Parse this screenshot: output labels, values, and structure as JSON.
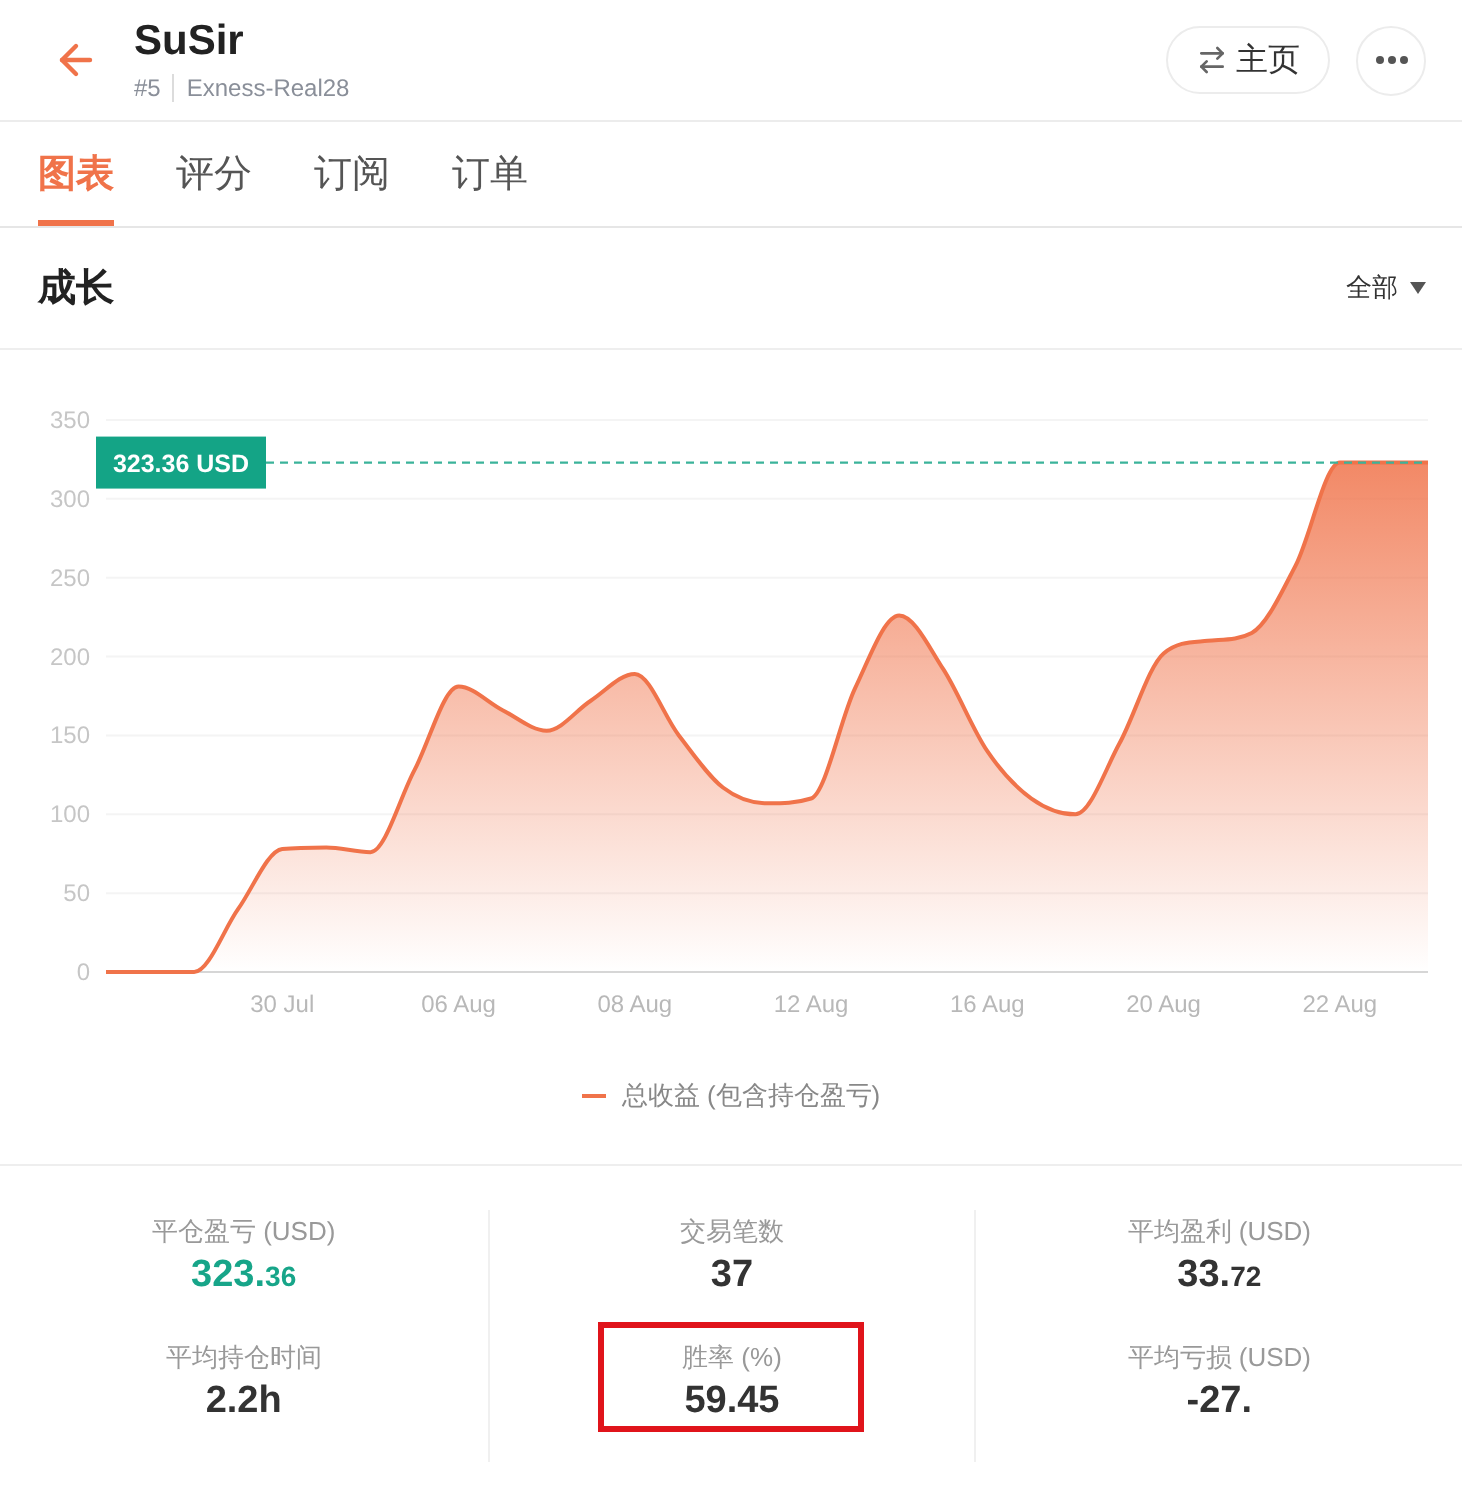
{
  "header": {
    "title": "SuSir",
    "rank": "#5",
    "account": "Exness-Real28",
    "home_button": "主页"
  },
  "tabs": [
    {
      "label": "图表",
      "selected": true
    },
    {
      "label": "评分",
      "selected": false
    },
    {
      "label": "订阅",
      "selected": false
    },
    {
      "label": "订单",
      "selected": false
    }
  ],
  "growth": {
    "title": "成长",
    "filter": "全部",
    "chart_data": {
      "type": "area",
      "categories": [
        null,
        null,
        null,
        null,
        "30 Jul",
        null,
        null,
        null,
        "06 Aug",
        null,
        null,
        null,
        "08 Aug",
        null,
        null,
        null,
        "12 Aug",
        null,
        null,
        null,
        "16 Aug",
        null,
        null,
        null,
        "20 Aug",
        null,
        null,
        null,
        "22 Aug",
        null,
        null
      ],
      "series": [
        {
          "name": "总收益 (包含持仓盈亏)",
          "color": "#f0734a",
          "values": [
            0,
            0,
            0,
            40,
            78,
            79,
            76,
            128,
            181,
            166,
            153,
            172,
            189,
            150,
            117,
            107,
            110,
            180,
            226,
            192,
            140,
            110,
            100,
            145,
            202,
            210,
            215,
            258,
            323,
            323,
            323
          ]
        }
      ],
      "ylim": [
        0,
        350
      ],
      "yticks": [
        0,
        50,
        100,
        150,
        200,
        250,
        300,
        350
      ],
      "grid": true,
      "ref_lines": [
        {
          "axis": "y",
          "value": 323,
          "label": "323.36 USD"
        }
      ]
    }
  },
  "stats": [
    {
      "label": "平仓盈亏 (USD)",
      "value": "323.",
      "fraction": "36",
      "positive": true,
      "highlighted": false
    },
    {
      "label": "交易笔数",
      "value": "37",
      "positive": false,
      "highlighted": false
    },
    {
      "label": "平均盈利 (USD)",
      "value": "33.",
      "fraction": "72",
      "positive": false,
      "highlighted": false
    },
    {
      "label": "平均持仓时间",
      "value": "2.2h",
      "positive": false,
      "highlighted": false
    },
    {
      "label": "胜率 (%)",
      "value": "59.45",
      "positive": false,
      "highlighted": true
    },
    {
      "label": "平均亏损 (USD)",
      "value": "-27.",
      "positive": false,
      "highlighted": false
    }
  ]
}
